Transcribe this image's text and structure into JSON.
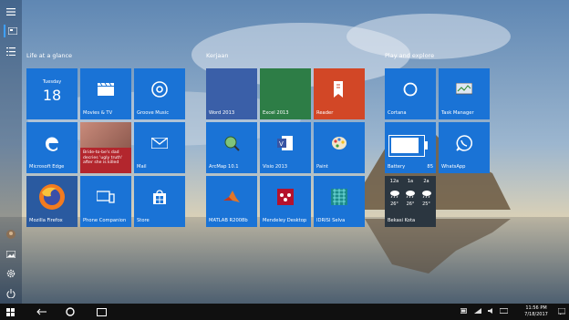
{
  "groups": {
    "life": "Life at a glance",
    "kerjaan": "Kerjaan",
    "play": "Play and explore"
  },
  "tiles": {
    "calendar": {
      "day": "Tuesday",
      "date": "18"
    },
    "movies": "Movies & TV",
    "groove": "Groove Music",
    "edge": "Microsoft Edge",
    "news": {
      "headline": "Bride-to-be's dad decries 'ugly truth' after she is killed"
    },
    "mail": "Mail",
    "firefox": "Mozilla Firefox",
    "phone": "Phone Companion",
    "store": "Store",
    "word": "Word 2013",
    "excel": "Excel 2013",
    "reader": "Reader",
    "arcmap": "ArcMap 10.1",
    "visio": "Visio 2013",
    "paint": "Paint",
    "matlab": "MATLAB R2008b",
    "mendeley": "Mendeley Desktop",
    "idrisi": "IDRISI Selva",
    "cortana": "Cortana",
    "taskmgr": "Task Manager",
    "battery": {
      "label": "Battery",
      "value": "85"
    },
    "whatsapp": "WhatsApp",
    "weather": {
      "label": "Bekasi Kota",
      "days": [
        {
          "day": "12a",
          "temp": "26°"
        },
        {
          "day": "1a",
          "temp": "26°"
        },
        {
          "day": "2a",
          "temp": "25°"
        }
      ]
    }
  },
  "taskbar": {
    "time": "11:56 PM",
    "date": "7/18/2017"
  },
  "colors": {
    "tile": "#1a73d6",
    "word": "#3a5fa8",
    "excel": "#2d7d46",
    "reader": "#d24726",
    "taskbar": "#101010"
  },
  "icons": [
    "hamburger-icon",
    "all-tiles-icon",
    "all-apps-icon",
    "user-avatar",
    "photos-icon",
    "settings-icon",
    "power-icon",
    "windows-start-icon",
    "back-icon",
    "search-circle-icon",
    "task-view-icon"
  ]
}
